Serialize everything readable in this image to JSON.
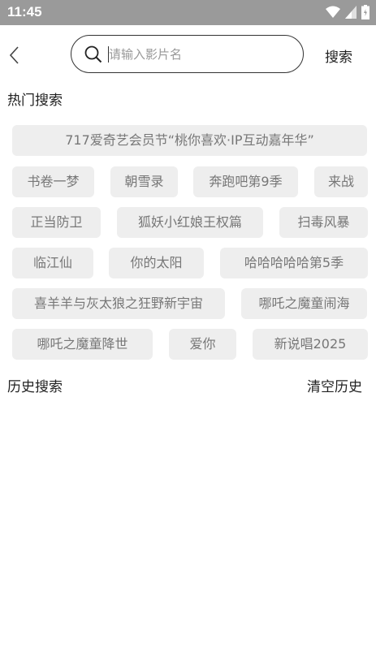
{
  "status_bar": {
    "time": "11:45"
  },
  "search": {
    "placeholder": "请输入影片名",
    "value": "",
    "button_label": "搜索"
  },
  "hot": {
    "title": "热门搜索",
    "tags": [
      "717爱奇艺会员节“桃你喜欢·IP互动嘉年华”",
      "书卷一梦",
      "朝雪录",
      "奔跑吧第9季",
      "来战",
      "正当防卫",
      "狐妖小红娘王权篇",
      "扫毒风暴",
      "临江仙",
      "你的太阳",
      "哈哈哈哈哈第5季",
      "喜羊羊与灰太狼之狂野新宇宙",
      "哪吒之魔童闹海",
      "哪吒之魔童降世",
      "爱你",
      "新说唱2025"
    ]
  },
  "history": {
    "title": "历史搜索",
    "clear_label": "清空历史"
  },
  "colors": {
    "status_bar": "#9a9a9a",
    "tag_bg": "#eeeeee",
    "tag_text": "#777777"
  }
}
